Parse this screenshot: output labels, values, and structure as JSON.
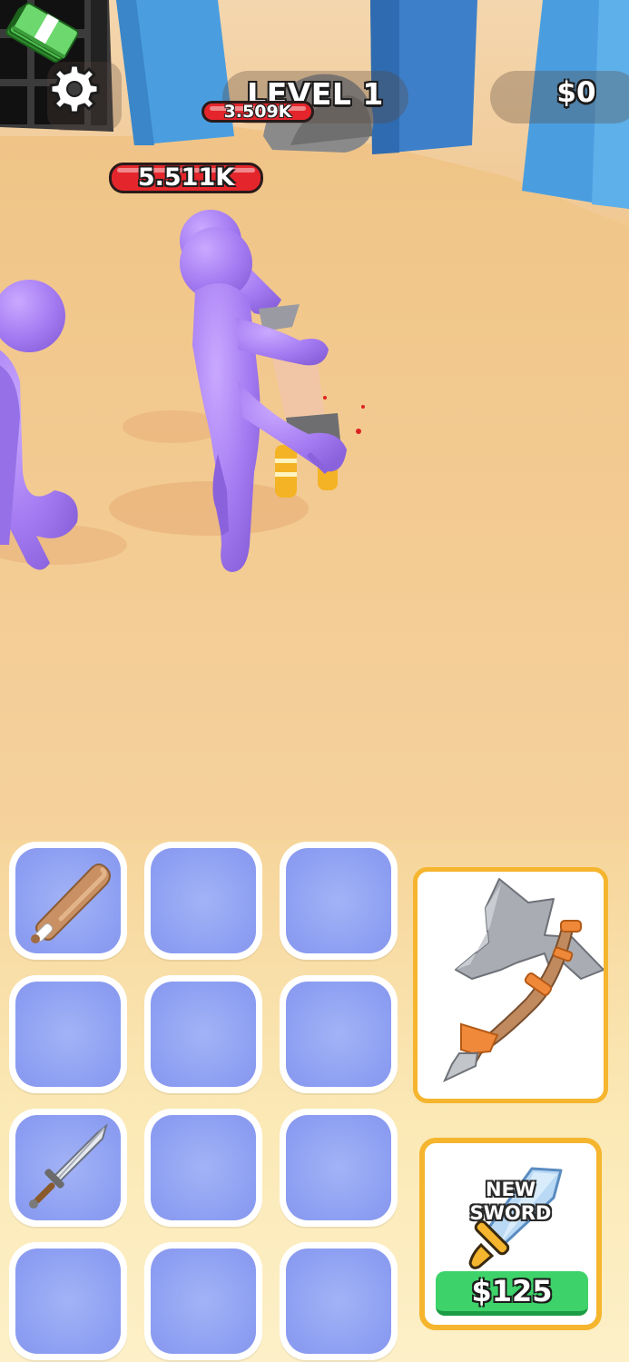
{
  "hud": {
    "settings_icon": "gear-icon",
    "level_label": "LEVEL 1",
    "cash_icon": "cash-stack-icon",
    "cash_value": "$0"
  },
  "enemies": {
    "main_health": "5.511K",
    "back_health": "3.509K"
  },
  "inventory": {
    "slots": [
      {
        "item": "baseball-bat"
      },
      {
        "item": null
      },
      {
        "item": null
      },
      {
        "item": null
      },
      {
        "item": null
      },
      {
        "item": null
      },
      {
        "item": "sword"
      },
      {
        "item": null
      },
      {
        "item": null
      },
      {
        "item": null
      },
      {
        "item": null
      },
      {
        "item": null
      }
    ]
  },
  "preview": {
    "item": "stone-axe"
  },
  "shop": {
    "title_line1": "NEW",
    "title_line2": "SWORD",
    "price": "$125"
  },
  "colors": {
    "sand": "#f2c98e",
    "enemy_purple": "#a77ef0",
    "slot_blue": "#8d9ff2",
    "card_border": "#f5b52e",
    "buy_green": "#3ed36a",
    "health_red": "#e4262c"
  }
}
